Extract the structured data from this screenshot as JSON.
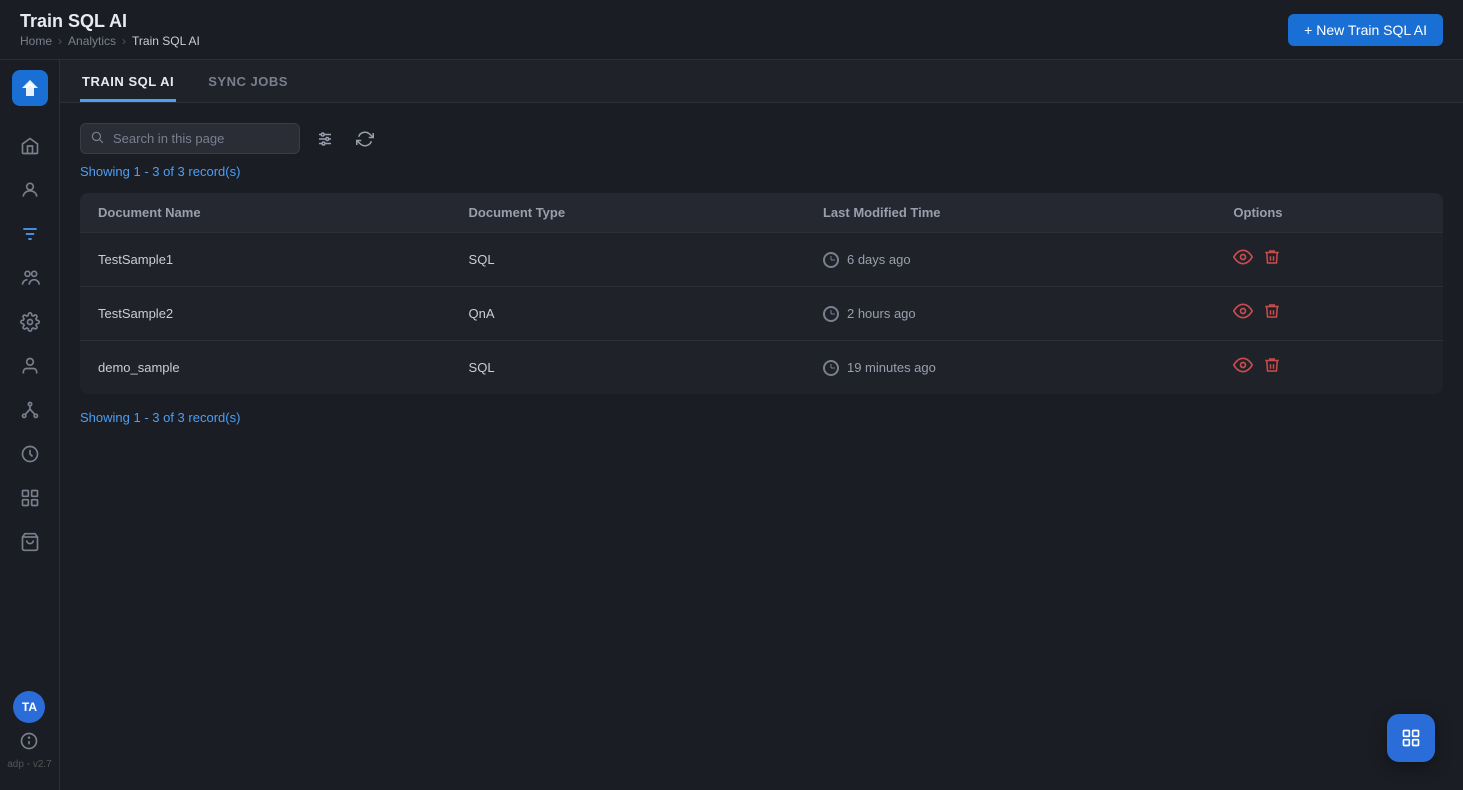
{
  "app": {
    "logo_initials": "TA",
    "version": "adp - v2.7"
  },
  "header": {
    "title": "Train SQL AI",
    "breadcrumb": {
      "home": "Home",
      "analytics": "Analytics",
      "current": "Train SQL AI"
    },
    "new_button_label": "+ New Train SQL AI"
  },
  "tabs": [
    {
      "id": "train-sql-ai",
      "label": "TRAIN SQL AI",
      "active": true
    },
    {
      "id": "sync-jobs",
      "label": "SYNC JOBS",
      "active": false
    }
  ],
  "sidebar": {
    "items": [
      {
        "id": "home",
        "icon": "home-icon"
      },
      {
        "id": "user",
        "icon": "user-icon"
      },
      {
        "id": "filter",
        "icon": "filter-icon"
      },
      {
        "id": "group",
        "icon": "group-icon"
      },
      {
        "id": "settings",
        "icon": "settings-icon"
      },
      {
        "id": "person",
        "icon": "person-icon"
      },
      {
        "id": "network",
        "icon": "network-icon"
      },
      {
        "id": "clock",
        "icon": "clock-icon"
      },
      {
        "id": "data",
        "icon": "data-icon"
      },
      {
        "id": "bag",
        "icon": "bag-icon"
      }
    ]
  },
  "search": {
    "placeholder": "Search in this page"
  },
  "table": {
    "records_label": "Showing 1 - 3 of 3 record(s)",
    "columns": [
      "Document Name",
      "Document Type",
      "Last Modified Time",
      "Options"
    ],
    "rows": [
      {
        "document_name": "TestSample1",
        "document_type": "SQL",
        "last_modified": "6 days ago"
      },
      {
        "document_name": "TestSample2",
        "document_type": "QnA",
        "last_modified": "2 hours ago"
      },
      {
        "document_name": "demo_sample",
        "document_type": "SQL",
        "last_modified": "19 minutes ago"
      }
    ],
    "records_bottom_label": "Showing 1 - 3 of 3 record(s)"
  }
}
